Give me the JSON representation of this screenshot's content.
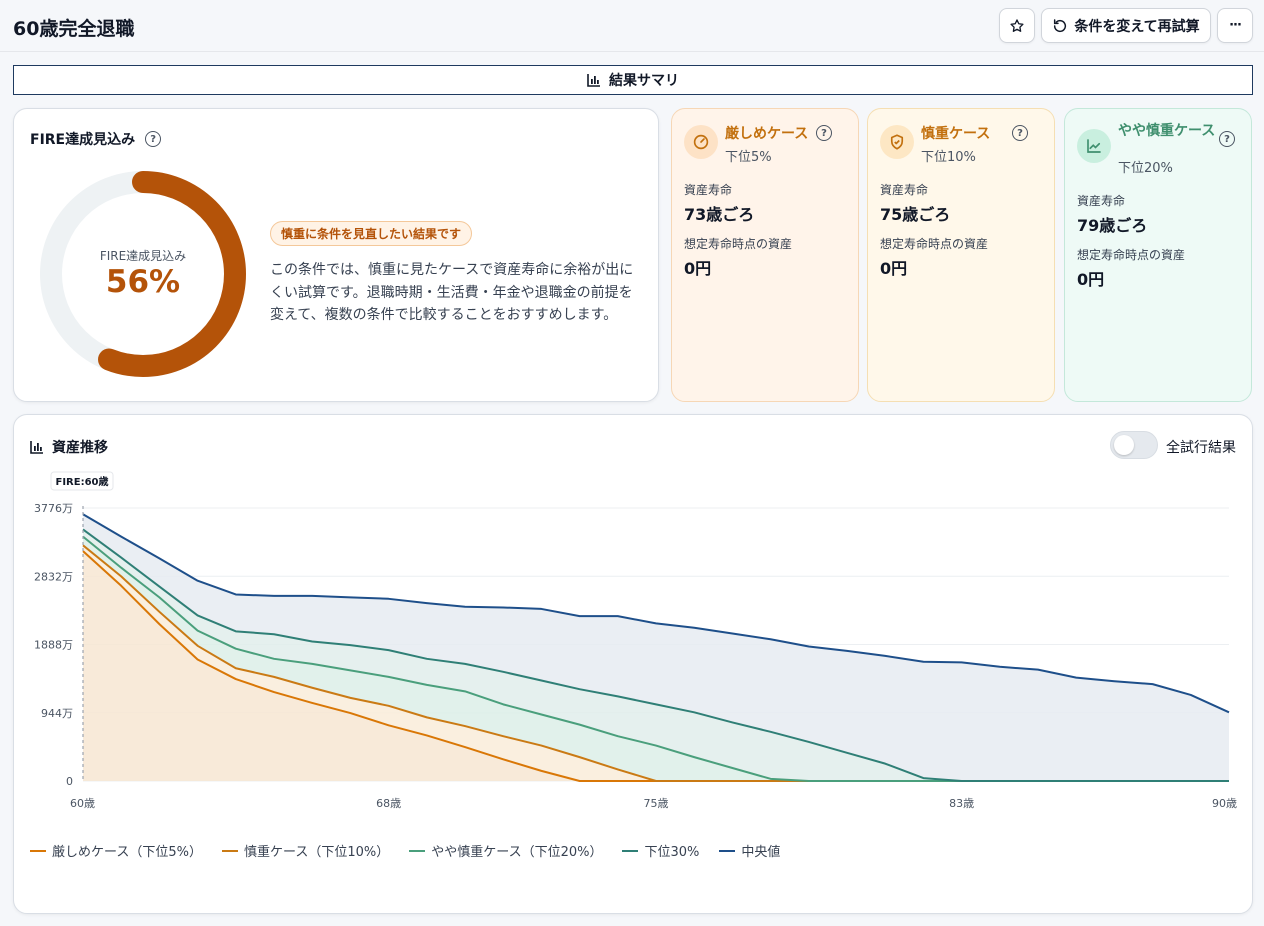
{
  "header": {
    "title": "60歳完全退職",
    "star_icon": "star-icon",
    "retry_label": "条件を変えて再試算",
    "more_label": "···"
  },
  "tab": {
    "label": "結果サマリ"
  },
  "fire": {
    "title": "FIRE達成見込み",
    "donut_label": "FIRE達成見込み",
    "value_text": "56%",
    "probability": 0.56,
    "badge": "慎重に条件を見直したい結果です",
    "description": "この条件では、慎重に見たケースで資産寿命に余裕が出にくい試算です。退職時期・生活費・年金や退職金の前提を変えて、複数の条件で比較することをおすすめします。",
    "colors": {
      "arc": "#b45309",
      "track": "#eef2f4"
    }
  },
  "cases": [
    {
      "name": "厳しめケース",
      "sub": "下位5%",
      "life_label": "資産寿命",
      "life": "73歳ごろ",
      "asset_label": "想定寿命時点の資産",
      "asset": "0円",
      "color": "#c2700e",
      "bg": "#fff4ea",
      "border": "#f6d7b6",
      "icon": "gauge-icon"
    },
    {
      "name": "慎重ケース",
      "sub": "下位10%",
      "life_label": "資産寿命",
      "life": "75歳ごろ",
      "asset_label": "想定寿命時点の資産",
      "asset": "0円",
      "color": "#c2700e",
      "bg": "#fff8ea",
      "border": "#f5dfb3",
      "icon": "shield-icon"
    },
    {
      "name": "やや慎重ケース",
      "sub": "下位20%",
      "life_label": "資産寿命",
      "life": "79歳ごろ",
      "asset_label": "想定寿命時点の資産",
      "asset": "0円",
      "color": "#3f8f6e",
      "bg": "#eefaf6",
      "border": "#c4e8da",
      "icon": "trend-chart-icon"
    }
  ],
  "chart": {
    "title": "資産推移",
    "toggle_label": "全試行結果",
    "toggle_on": false,
    "fire_marker": "FIRE:60歳"
  },
  "chart_data": {
    "type": "area",
    "x": [
      60,
      61,
      62,
      63,
      64,
      65,
      66,
      67,
      68,
      69,
      70,
      71,
      72,
      73,
      74,
      75,
      76,
      77,
      78,
      79,
      80,
      81,
      82,
      83,
      84,
      85,
      86,
      87,
      88,
      89,
      90
    ],
    "x_ticks": [
      60,
      68,
      75,
      83,
      90
    ],
    "x_tick_labels": [
      "60歳",
      "68歳",
      "75歳",
      "83歳",
      "90歳"
    ],
    "y_ticks": [
      0,
      944,
      1888,
      2832,
      3776
    ],
    "y_tick_labels": [
      "0",
      "944万",
      "1888万",
      "2832万",
      "3776万"
    ],
    "ylim": [
      0,
      3776
    ],
    "grid": true,
    "legend_position": "bottom-left",
    "series": [
      {
        "name": "厳しめケース（下位5%）",
        "color": "#d97706",
        "values": [
          3180,
          2700,
          2170,
          1680,
          1410,
          1230,
          1080,
          940,
          770,
          630,
          470,
          300,
          140,
          0,
          0,
          0,
          0,
          0,
          0,
          0,
          0,
          0,
          0,
          0,
          0,
          0,
          0,
          0,
          0,
          0,
          0
        ]
      },
      {
        "name": "慎重ケース（下位10%）",
        "color": "#ca7a14",
        "values": [
          3260,
          2830,
          2340,
          1870,
          1560,
          1440,
          1290,
          1150,
          1040,
          880,
          760,
          620,
          490,
          330,
          160,
          0,
          0,
          0,
          0,
          0,
          0,
          0,
          0,
          0,
          0,
          0,
          0,
          0,
          0,
          0,
          0
        ]
      },
      {
        "name": "やや慎重ケース（下位20%）",
        "color": "#4a9f7c",
        "values": [
          3380,
          2950,
          2540,
          2080,
          1830,
          1690,
          1620,
          1530,
          1440,
          1330,
          1240,
          1060,
          920,
          780,
          620,
          490,
          330,
          180,
          30,
          0,
          0,
          0,
          0,
          0,
          0,
          0,
          0,
          0,
          0,
          0,
          0
        ]
      },
      {
        "name": "下位30%",
        "color": "#2f7f76",
        "values": [
          3480,
          3090,
          2690,
          2290,
          2070,
          2030,
          1930,
          1880,
          1810,
          1690,
          1620,
          1510,
          1390,
          1270,
          1170,
          1060,
          950,
          810,
          680,
          540,
          390,
          240,
          40,
          0,
          0,
          0,
          0,
          0,
          0,
          0,
          0
        ]
      },
      {
        "name": "中央値",
        "color": "#1e4f8a",
        "values": [
          3690,
          3380,
          3080,
          2770,
          2580,
          2560,
          2560,
          2540,
          2520,
          2460,
          2410,
          2400,
          2380,
          2280,
          2280,
          2180,
          2120,
          2040,
          1960,
          1860,
          1800,
          1730,
          1650,
          1640,
          1580,
          1540,
          1430,
          1380,
          1340,
          1190,
          950
        ]
      }
    ]
  }
}
